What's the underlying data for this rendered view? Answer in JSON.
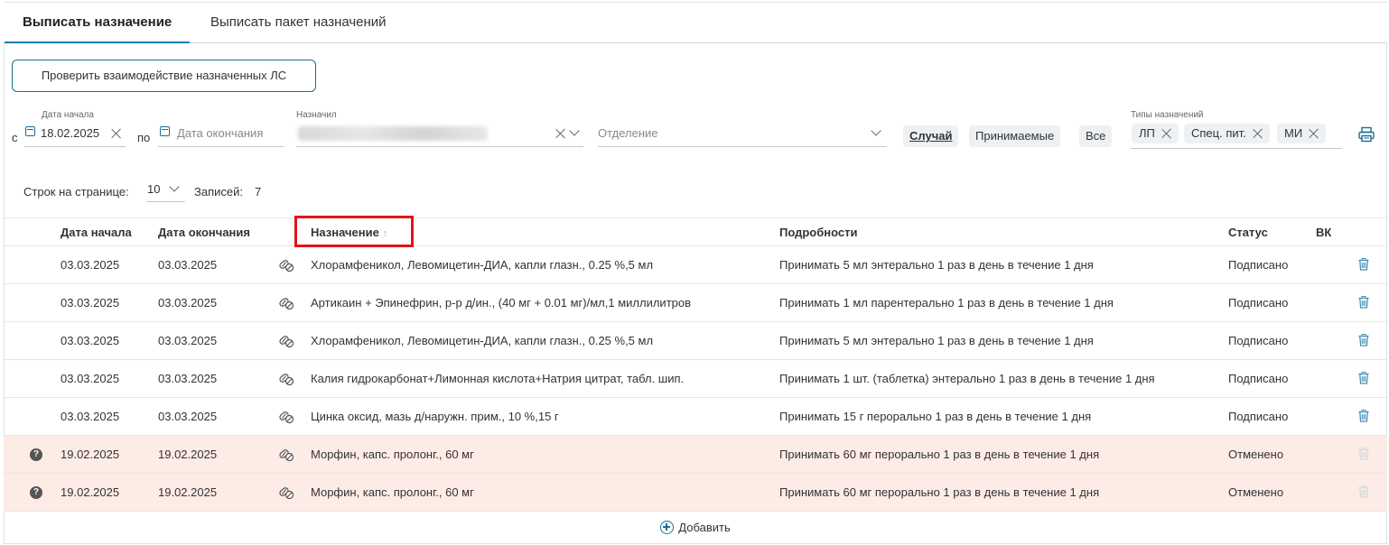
{
  "tabs": [
    {
      "label": "Выписать назначение",
      "active": true
    },
    {
      "label": "Выписать пакет назначений",
      "active": false
    }
  ],
  "toolbar": {
    "check_interactions_label": "Проверить взаимодействие назначенных ЛС"
  },
  "filters": {
    "from_prefix": "с",
    "start_date_label": "Дата начала",
    "start_date_value": "18.02.2025",
    "to_prefix": "по",
    "end_date_placeholder": "Дата окончания",
    "prescriber_label": "Назначил",
    "department_placeholder": "Отделение",
    "case_btn": "Случай",
    "accepted_btn": "Принимаемые",
    "all_btn": "Все",
    "types_label": "Типы назначений",
    "type_chips": [
      "ЛП",
      "Спец. пит.",
      "МИ"
    ]
  },
  "pagination": {
    "rows_per_page_label": "Строк на странице:",
    "rows_per_page_value": "10",
    "records_label": "Записей:",
    "records_count": "7"
  },
  "table": {
    "columns": {
      "start": "Дата начала",
      "end": "Дата окончания",
      "name": "Назначение",
      "details": "Подробности",
      "status": "Статус",
      "vk": "ВК"
    },
    "sort_arrow": "↑",
    "rows": [
      {
        "start": "03.03.2025",
        "end": "03.03.2025",
        "name": "Хлорамфеникол, Левомицетин-ДИА, капли глазн., 0.25 %,5 мл",
        "details": "Принимать 5 мл энтерально 1 раз в день в течение 1 дня",
        "status": "Подписано",
        "cancelled": false
      },
      {
        "start": "03.03.2025",
        "end": "03.03.2025",
        "name": "Артикаин + Эпинефрин, р-р д/ин., (40 мг + 0.01 мг)/мл,1 миллилитров",
        "details": "Принимать 1 мл парентерально 1 раз в день в течение 1 дня",
        "status": "Подписано",
        "cancelled": false
      },
      {
        "start": "03.03.2025",
        "end": "03.03.2025",
        "name": "Хлорамфеникол, Левомицетин-ДИА, капли глазн., 0.25 %,5 мл",
        "details": "Принимать 5 мл энтерально 1 раз в день в течение 1 дня",
        "status": "Подписано",
        "cancelled": false
      },
      {
        "start": "03.03.2025",
        "end": "03.03.2025",
        "name": "Калия гидрокарбонат+Лимонная кислота+Натрия цитрат, табл. шип.",
        "details": "Принимать 1 шт. (таблетка) энтерально 1 раз в день в течение 1 дня",
        "status": "Подписано",
        "cancelled": false
      },
      {
        "start": "03.03.2025",
        "end": "03.03.2025",
        "name": "Цинка оксид, мазь д/наружн. прим., 10 %,15 г",
        "details": "Принимать 15 г перорально 1 раз в день в течение 1 дня",
        "status": "Подписано",
        "cancelled": false
      },
      {
        "start": "19.02.2025",
        "end": "19.02.2025",
        "name": "Морфин, капс. пролонг., 60 мг",
        "details": "Принимать 60 мг перорально 1 раз в день в течение 1 дня",
        "status": "Отменено",
        "cancelled": true
      },
      {
        "start": "19.02.2025",
        "end": "19.02.2025",
        "name": "Морфин, капс. пролонг., 60 мг",
        "details": "Принимать 60 мг перорально 1 раз в день в течение 1 дня",
        "status": "Отменено",
        "cancelled": true
      }
    ],
    "question_mark": "?"
  },
  "footer": {
    "add_label": "Добавить"
  },
  "colors": {
    "accent": "#1b6e93",
    "cancelled_row": "#fdebe6",
    "highlight_box": "#e0151b"
  }
}
